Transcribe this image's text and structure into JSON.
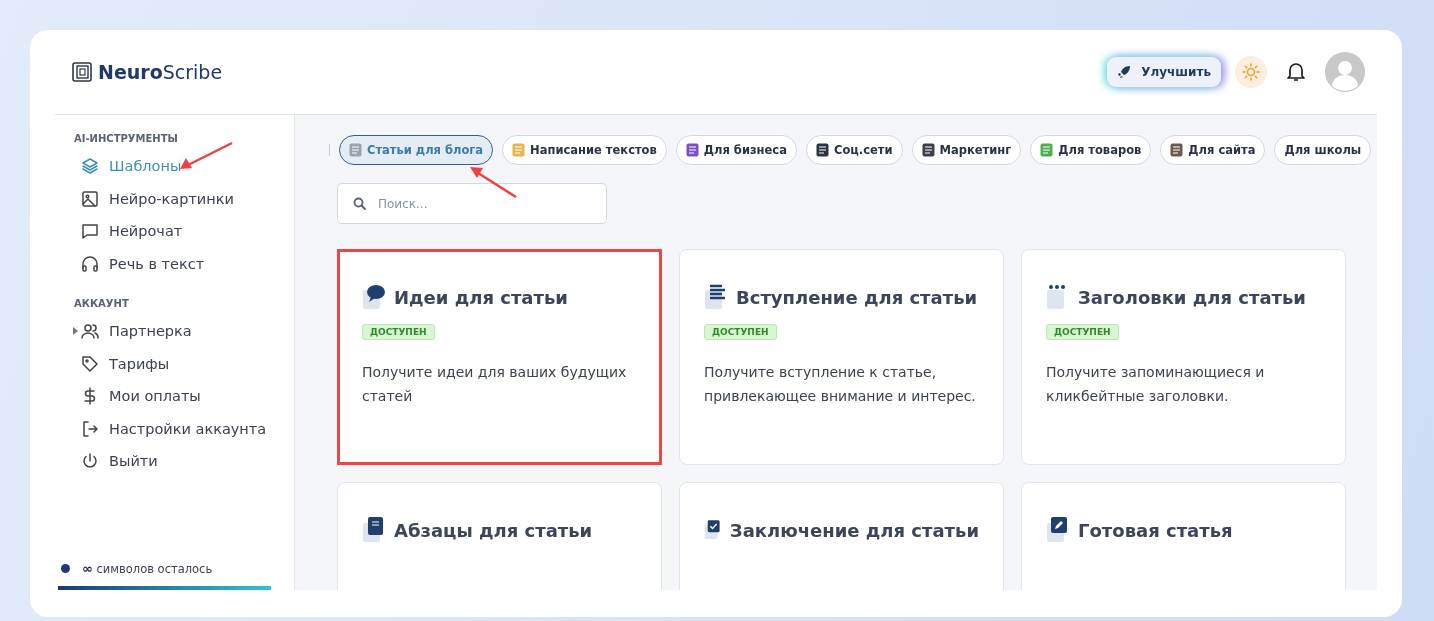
{
  "brand": {
    "bold": "Neuro",
    "rest": "Scribe"
  },
  "header": {
    "upgrade_label": "Улучшить"
  },
  "sidebar": {
    "sections": [
      {
        "title": "AI-ИНСТРУМЕНТЫ",
        "items": [
          {
            "label": "Шаблоны",
            "selected": true,
            "expandable": false
          },
          {
            "label": "Нейро-картинки",
            "selected": false,
            "expandable": false
          },
          {
            "label": "Нейрочат",
            "selected": false,
            "expandable": false
          },
          {
            "label": "Речь в текст",
            "selected": false,
            "expandable": false
          }
        ]
      },
      {
        "title": "АККАУНТ",
        "items": [
          {
            "label": "Партнерка",
            "selected": false,
            "expandable": true
          },
          {
            "label": "Тарифы",
            "selected": false,
            "expandable": false
          },
          {
            "label": "Мои оплаты",
            "selected": false,
            "expandable": false
          },
          {
            "label": "Настройки аккаунта",
            "selected": false,
            "expandable": false
          },
          {
            "label": "Выйти",
            "selected": false,
            "expandable": false
          }
        ]
      }
    ],
    "quota": {
      "symbol": "∞",
      "text": "символов осталось",
      "level": 1
    }
  },
  "categories": [
    {
      "label": "Статьи для блога",
      "selected": true
    },
    {
      "label": "Написание текстов",
      "selected": false
    },
    {
      "label": "Для бизнеса",
      "selected": false
    },
    {
      "label": "Соц.сети",
      "selected": false
    },
    {
      "label": "Маркетинг",
      "selected": false
    },
    {
      "label": "Для товаров",
      "selected": false
    },
    {
      "label": "Для сайта",
      "selected": false
    },
    {
      "label": "Для школы",
      "selected": false
    }
  ],
  "search": {
    "placeholder": "Поиск..."
  },
  "cards": [
    {
      "title": "Идеи для статьи",
      "badge": "ДОСТУПЕН",
      "description": "Получите идеи для ваших будущих статей",
      "highlighted": true
    },
    {
      "title": "Вступление для статьи",
      "badge": "ДОСТУПЕН",
      "description": "Получите вступление к статье, привлекающее внимание и интерес.",
      "highlighted": false
    },
    {
      "title": "Заголовки для статьи",
      "badge": "ДОСТУПЕН",
      "description": "Получите запоминающиеся и кликбейтные заголовки.",
      "highlighted": false
    },
    {
      "title": "Абзацы для статьи",
      "highlighted": false
    },
    {
      "title": "Заключение для статьи",
      "highlighted": false
    },
    {
      "title": "Готовая статья",
      "highlighted": false
    }
  ]
}
